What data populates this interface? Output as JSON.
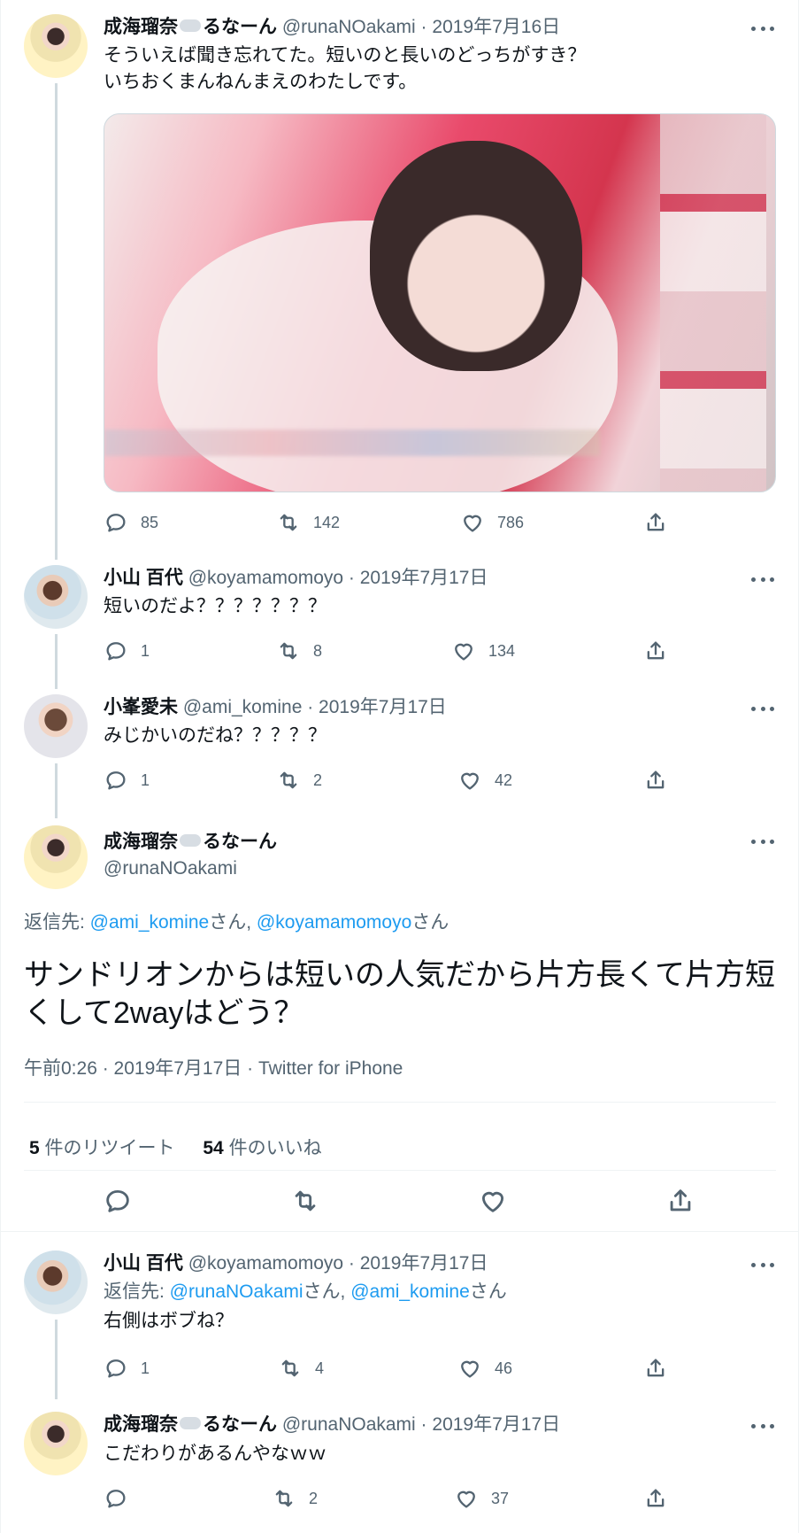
{
  "tweets": [
    {
      "name": "成海瑠奈",
      "name_suffix": "るなーん",
      "handle": "@runaNOakami",
      "date": "2019年7月16日",
      "text": "そういえば聞き忘れてた。短いのと長いのどっちがすき？\nいちおくまんねんまえのわたしです。",
      "replies": "85",
      "retweets": "142",
      "likes": "786"
    },
    {
      "name": "小山 百代",
      "handle": "@koyamamomoyo",
      "date": "2019年7月17日",
      "text": "短いのだよ？？？？？？？",
      "replies": "1",
      "retweets": "8",
      "likes": "134"
    },
    {
      "name": "小峯愛未",
      "handle": "@ami_komine",
      "date": "2019年7月17日",
      "text": "みじかいのだね？？？？？",
      "replies": "1",
      "retweets": "2",
      "likes": "42"
    }
  ],
  "main": {
    "name": "成海瑠奈",
    "name_suffix": "るなーん",
    "handle": "@runaNOakami",
    "reply_prefix": "返信先: ",
    "reply_to_1": "@ami_komine",
    "san_1": "さん, ",
    "reply_to_2": "@koyamamomoyo",
    "san_2": "さん",
    "text": "サンドリオンからは短いの人気だから片方長くて片方短くして2wayはどう？",
    "meta": "午前0:26 · 2019年7月17日 · Twitter for iPhone",
    "retweet_count": "5",
    "retweet_label": " 件のリツイート",
    "like_count": "54",
    "like_label": " 件のいいね"
  },
  "replies": [
    {
      "name": "小山 百代",
      "handle": "@koyamamomoyo",
      "date": "2019年7月17日",
      "reply_prefix": "返信先: ",
      "reply_to_1": "@runaNOakami",
      "san_1": "さん, ",
      "reply_to_2": "@ami_komine",
      "san_2": "さん",
      "text": "右側はボブね？",
      "replies": "1",
      "retweets": "4",
      "likes": "46"
    },
    {
      "name": "成海瑠奈",
      "name_suffix": "るなーん",
      "handle": "@runaNOakami",
      "date": "2019年7月17日",
      "text": "こだわりがあるんやなｗｗ",
      "replies": "",
      "retweets": "2",
      "likes": "37"
    }
  ],
  "ui": {
    "sep": " · "
  },
  "icons": [
    "reply-icon",
    "retweet-icon",
    "like-icon",
    "share-icon",
    "more-icon",
    "cloud-emoji-icon"
  ],
  "colors": {
    "link": "#1d9bf0",
    "secondary": "#536471",
    "text": "#0f1419"
  }
}
